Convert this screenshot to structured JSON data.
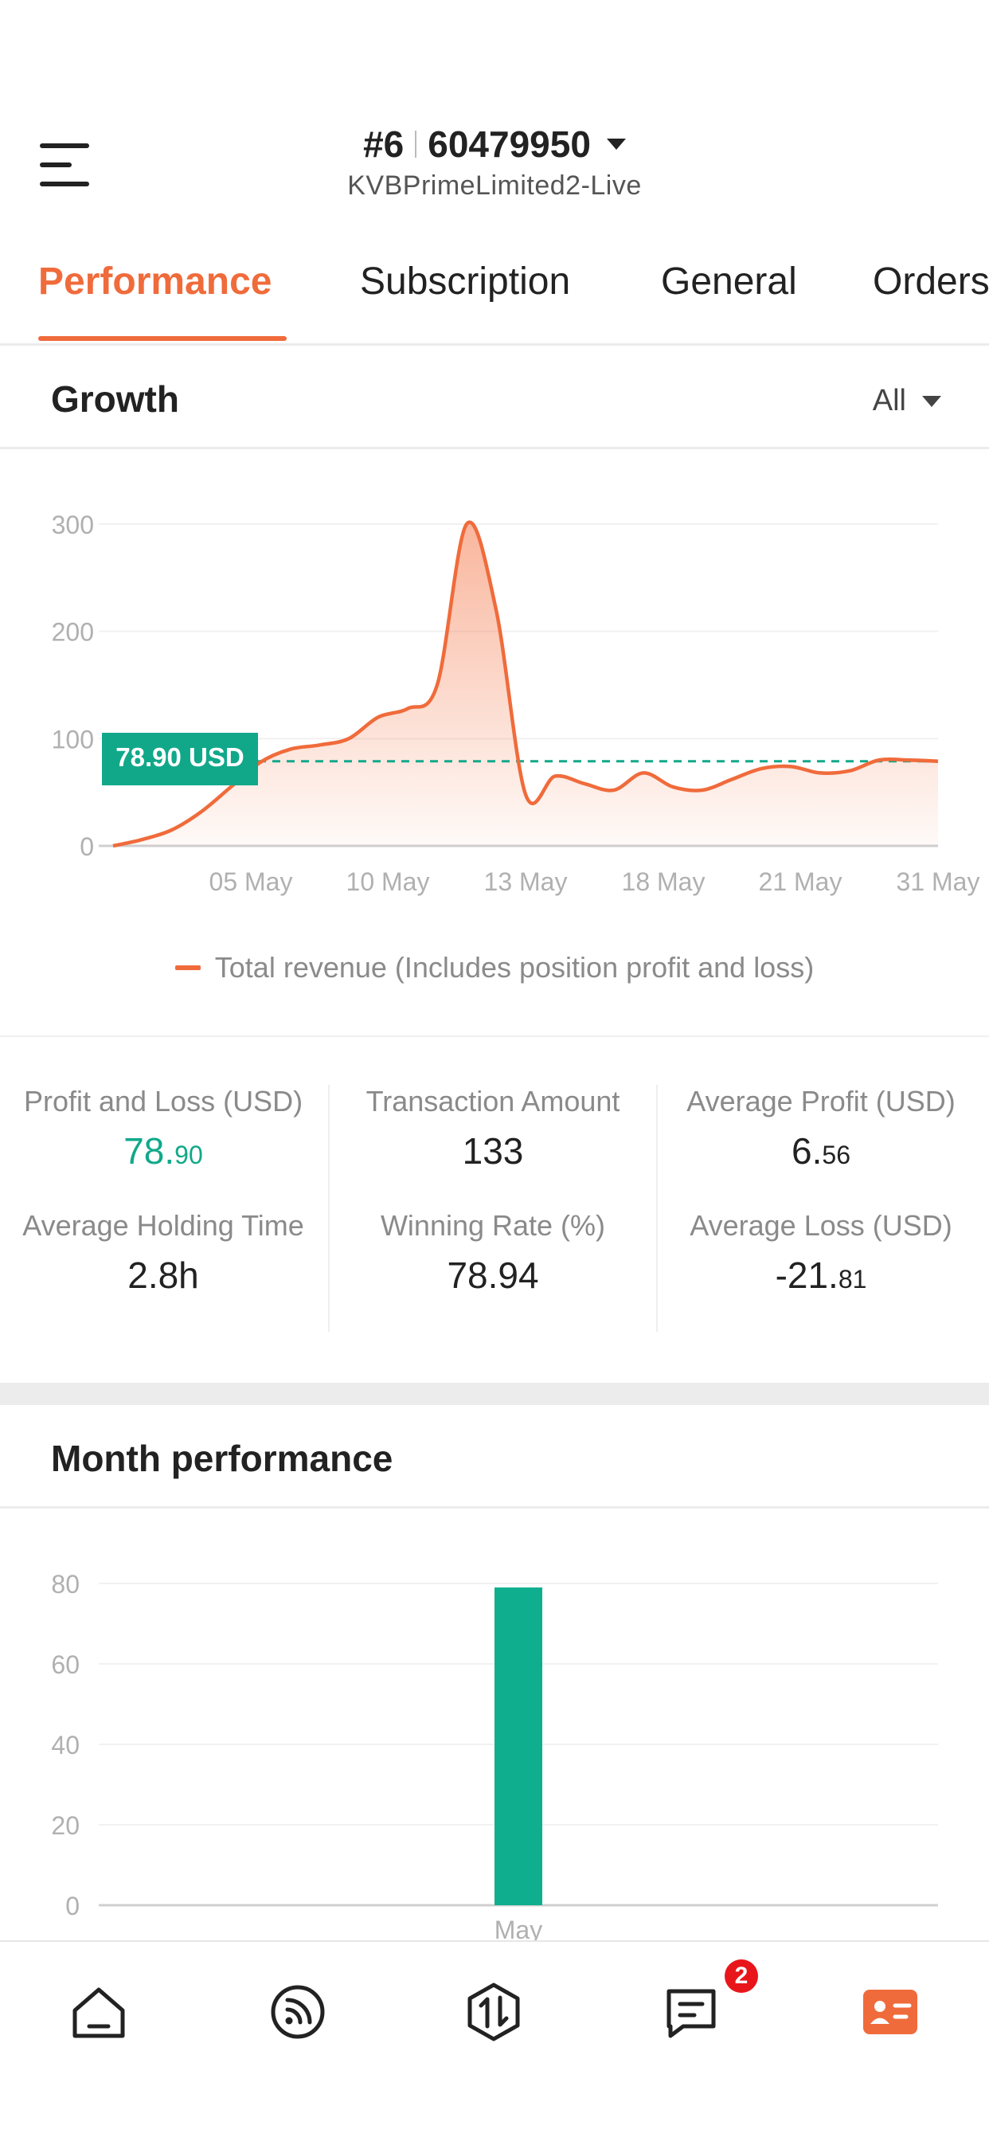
{
  "header": {
    "account_rank": "#6",
    "account_number": "60479950",
    "server_name": "KVBPrimeLimited2-Live"
  },
  "tabs": [
    {
      "label": "Performance",
      "active": true
    },
    {
      "label": "Subscription",
      "active": false
    },
    {
      "label": "General",
      "active": false
    },
    {
      "label": "Orders",
      "active": false
    }
  ],
  "growth": {
    "title": "Growth",
    "filter_label": "All",
    "current_value_label": "78.90 USD",
    "legend": "Total revenue (Includes position profit and loss)"
  },
  "stats": {
    "pnl": {
      "label": "Profit and Loss (USD)",
      "value_int": "78.",
      "value_dec": "90"
    },
    "holding": {
      "label": "Average Holding Time",
      "value": "2.8h"
    },
    "tx_amount": {
      "label": "Transaction Amount",
      "value": "133"
    },
    "win_rate": {
      "label": "Winning Rate (%)",
      "value": "78.94"
    },
    "avg_profit": {
      "label": "Average Profit (USD)",
      "value_int": "6.",
      "value_dec": "56"
    },
    "avg_loss": {
      "label": "Average Loss (USD)",
      "value_int": "-21.",
      "value_dec": "81"
    }
  },
  "month": {
    "title": "Month performance"
  },
  "tabbar": {
    "messages_badge": "2",
    "items": [
      "home-icon",
      "feed-icon",
      "trade-icon",
      "messages-icon",
      "profile-card-icon"
    ]
  },
  "colors": {
    "accent": "#f06b3b",
    "positive": "#11a88a",
    "badge": "#e8161b"
  },
  "chart_data": [
    {
      "type": "area",
      "series": [
        {
          "values": [
            [
              0,
              0
            ],
            [
              1,
              6
            ],
            [
              2,
              15
            ],
            [
              3,
              32
            ],
            [
              4,
              55
            ],
            [
              5,
              78
            ],
            [
              6,
              90
            ],
            [
              7,
              94
            ],
            [
              8,
              100
            ],
            [
              9,
              120
            ],
            [
              10,
              128
            ],
            [
              11,
              150
            ],
            [
              12,
              300
            ],
            [
              13,
              220
            ],
            [
              14,
              48
            ],
            [
              15,
              65
            ],
            [
              16,
              58
            ],
            [
              17,
              52
            ],
            [
              18,
              68
            ],
            [
              19,
              55
            ],
            [
              20,
              52
            ],
            [
              21,
              62
            ],
            [
              22,
              72
            ],
            [
              23,
              74
            ],
            [
              24,
              68
            ],
            [
              25,
              70
            ],
            [
              26,
              80
            ],
            [
              27,
              80
            ],
            [
              28,
              78.9
            ]
          ]
        }
      ],
      "x_tick_labels": [
        "05 May",
        "10 May",
        "13 May",
        "18 May",
        "21 May",
        "31 May"
      ],
      "y_ticks": [
        0,
        100,
        200,
        300
      ],
      "ylim": [
        0,
        300
      ],
      "reference_line": 78.9,
      "grid": true
    },
    {
      "type": "bar",
      "categories": [
        "May"
      ],
      "values": [
        79
      ],
      "y_ticks": [
        0,
        20,
        40,
        60,
        80
      ],
      "ylim": [
        0,
        80
      ],
      "grid": true
    }
  ]
}
